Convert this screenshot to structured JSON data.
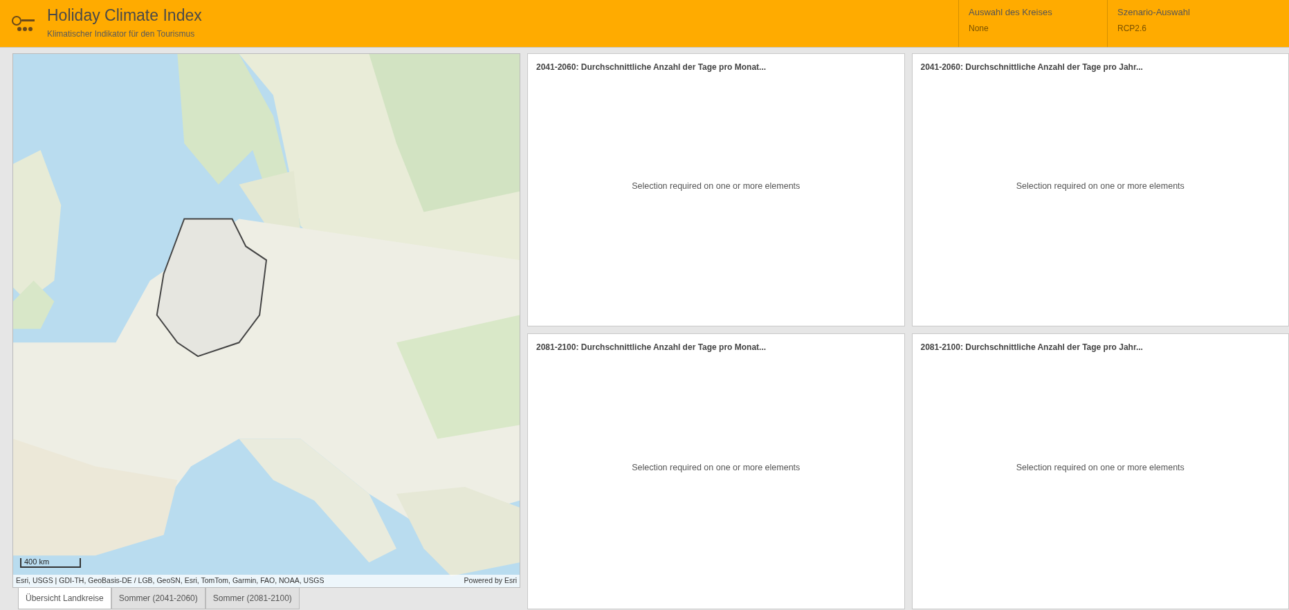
{
  "header": {
    "title": "Holiday Climate Index",
    "subtitle": "Klimatischer Indikator für den Tourismus",
    "selectors": [
      {
        "label": "Auswahl des Kreises",
        "value": "None"
      },
      {
        "label": "Szenario-Auswahl",
        "value": "RCP2.6"
      }
    ]
  },
  "map": {
    "scale_label": "400 km",
    "attribution": "Esri, USGS | GDI-TH, GeoBasis-DE / LGB, GeoSN, Esri, TomTom, Garmin, FAO, NOAA, USGS",
    "powered_by": "Powered by Esri"
  },
  "tabs": [
    {
      "label": "Übersicht Landkreise",
      "selected": true
    },
    {
      "label": "Sommer (2041-2060)",
      "selected": false
    },
    {
      "label": "Sommer (2081-2100)",
      "selected": false
    }
  ],
  "panels": [
    {
      "title": "2041-2060: Durchschnittliche Anzahl der Tage pro Monat...",
      "message": "Selection required on one or more elements"
    },
    {
      "title": "2041-2060: Durchschnittliche Anzahl der Tage pro Jahr...",
      "message": "Selection required on one or more elements"
    },
    {
      "title": "2081-2100: Durchschnittliche Anzahl der Tage pro Monat...",
      "message": "Selection required on one or more elements"
    },
    {
      "title": "2081-2100: Durchschnittliche Anzahl der Tage pro Jahr...",
      "message": "Selection required on one or more elements"
    }
  ]
}
